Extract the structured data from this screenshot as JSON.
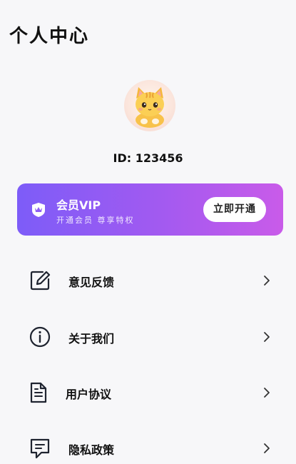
{
  "header": {
    "title": "个人中心"
  },
  "profile": {
    "id_text": "ID: 123456"
  },
  "vip": {
    "title": "会员VIP",
    "subtitle": "开通会员  尊享特权",
    "button_label": "立即开通",
    "gradient_start": "#7d5cf8",
    "gradient_end": "#c95be9"
  },
  "menu": {
    "items": [
      {
        "label": "意见反馈",
        "icon": "edit-icon"
      },
      {
        "label": "关于我们",
        "icon": "info-icon"
      },
      {
        "label": "用户协议",
        "icon": "document-icon"
      },
      {
        "label": "隐私政策",
        "icon": "message-icon"
      }
    ]
  }
}
